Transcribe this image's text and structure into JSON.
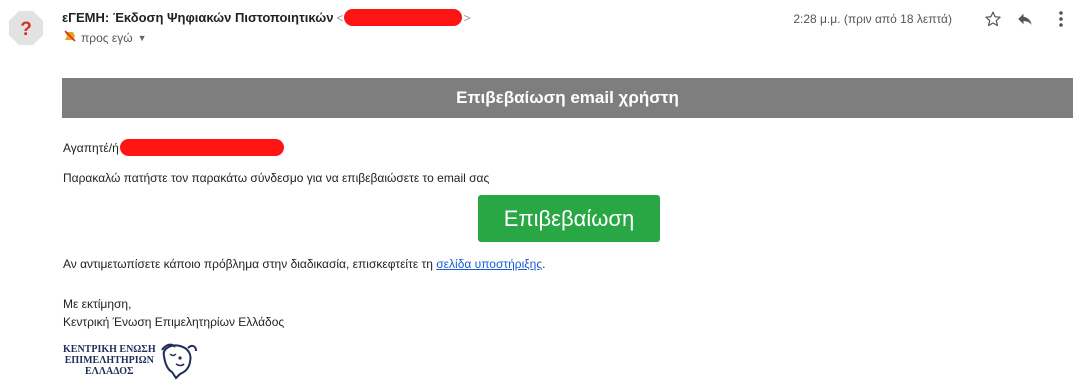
{
  "header": {
    "subject": "εΓΕΜΗ: Έκδοση Ψηφιακών Πιστοποιητικών",
    "recipient": "προς εγώ",
    "timestamp": "2:28 μ.μ. (πριν από 18 λεπτά)"
  },
  "icons": {
    "avatar": "question-mark-icon",
    "important": "important-flag-icon",
    "star": "star-icon",
    "reply": "reply-icon",
    "more": "more-vert-icon"
  },
  "colors": {
    "banner": "#7e7e7e",
    "button": "#29a745",
    "link": "#1a5bd6",
    "redaction": "#ff1414"
  },
  "email": {
    "banner_title": "Επιβεβαίωση email χρήστη",
    "greeting": "Αγαπητέ/ή",
    "instruction": "Παρακαλώ πατήστε τον παρακάτω σύνδεσμο για να επιβεβαιώσετε το email σας",
    "confirm_button": "Επιβεβαίωση",
    "help_prefix": "Αν αντιμετωπίσετε κάποιο πρόβλημα στην διαδικασία, επισκεφτείτε τη ",
    "help_link": "σελίδα υποστήριξης",
    "help_suffix": ".",
    "signoff": "Με εκτίμηση,",
    "signature": "Κεντρική Ένωση Επιμελητηρίων Ελλάδος"
  },
  "logo": {
    "line1": "ΚΕΝΤΡΙΚΗ ΕΝΩΣΗ",
    "line2": "ΕΠΙΜΕΛΗΤΗΡΙΩΝ",
    "line3": "ΕΛΛΑΔΟΣ"
  }
}
